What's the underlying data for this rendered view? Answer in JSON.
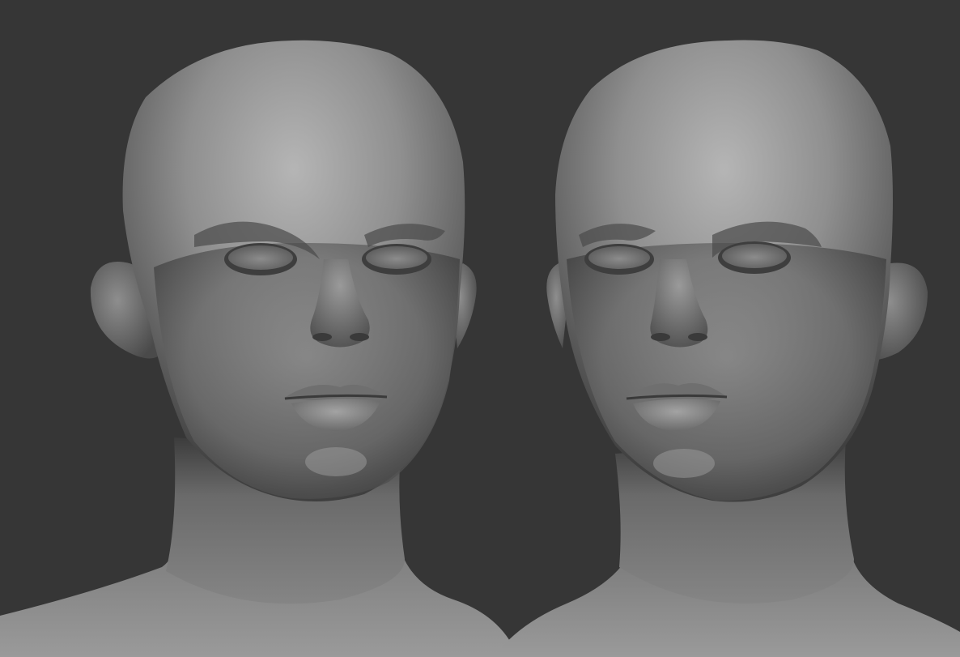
{
  "scene": {
    "background_color": "#363636",
    "clay_color": "#8c8c8c",
    "models": [
      {
        "name": "left",
        "view": "front-three-quarter-right"
      },
      {
        "name": "right",
        "view": "front-three-quarter-left"
      }
    ]
  }
}
